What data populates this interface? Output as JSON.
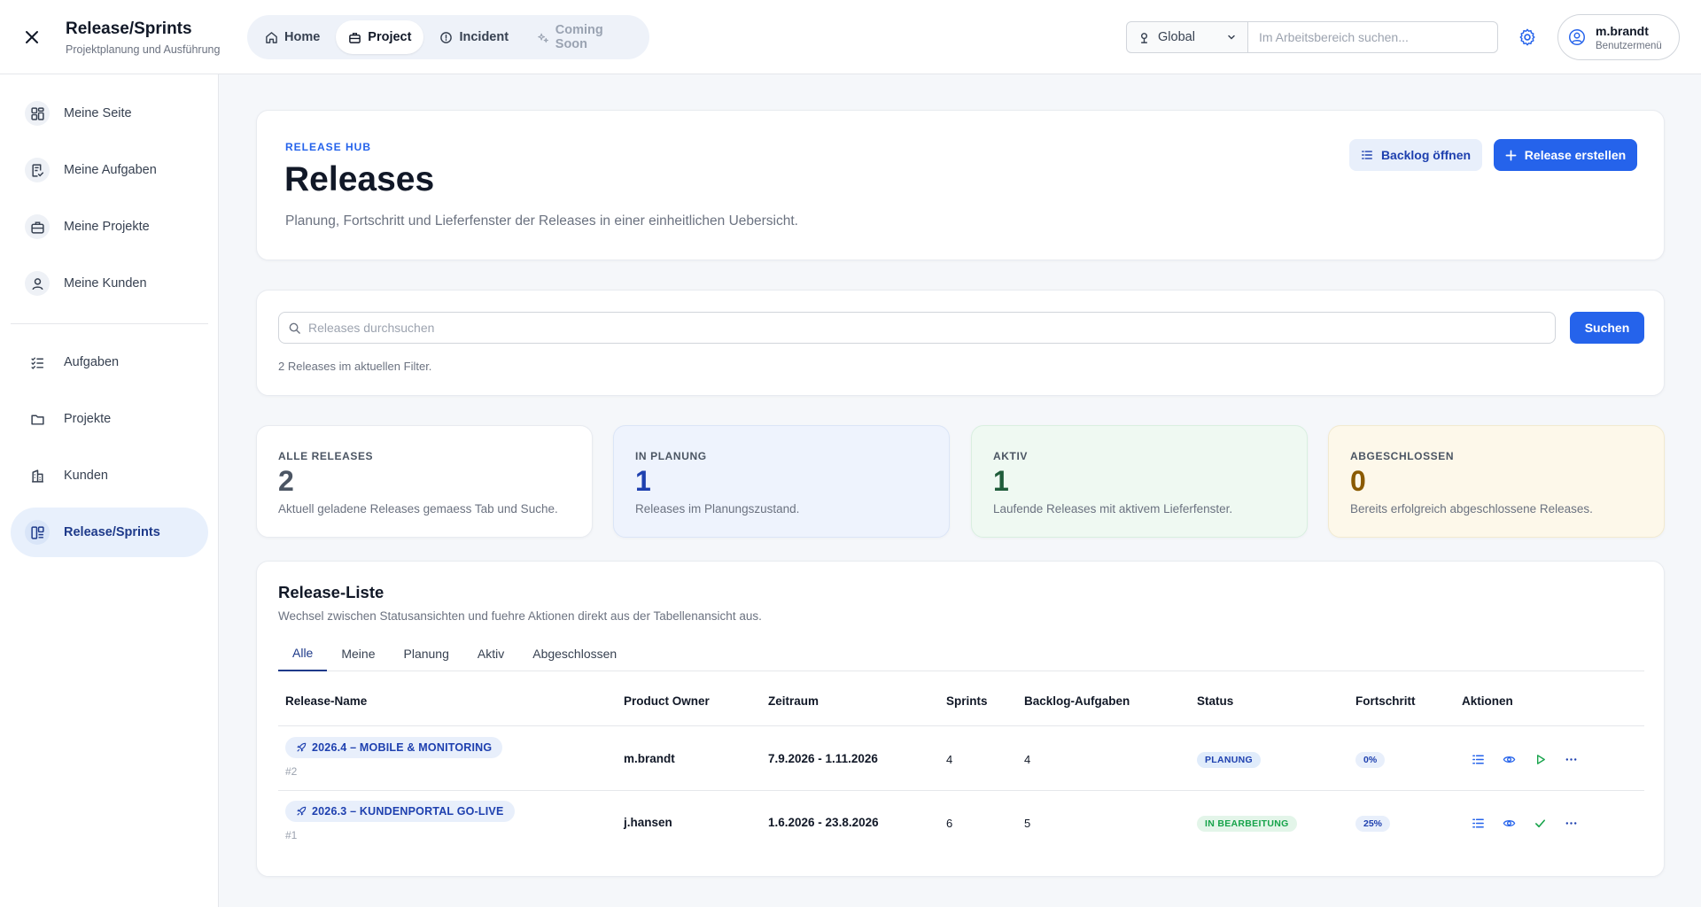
{
  "header": {
    "title": "Release/Sprints",
    "subtitle": "Projektplanung und Ausführung",
    "nav": [
      {
        "label": "Home",
        "icon": "home-icon"
      },
      {
        "label": "Project",
        "icon": "briefcase-icon"
      },
      {
        "label": "Incident",
        "icon": "alert-circle-icon"
      },
      {
        "label": "Coming Soon",
        "icon": "sparkle-icon"
      }
    ],
    "scope": "Global",
    "search_placeholder": "Im Arbeitsbereich suchen...",
    "user": {
      "name": "m.brandt",
      "role": "Benutzermenü"
    }
  },
  "sidebar": {
    "items": [
      {
        "label": "Meine Seite"
      },
      {
        "label": "Meine Aufgaben"
      },
      {
        "label": "Meine Projekte"
      },
      {
        "label": "Meine Kunden"
      },
      {
        "label": "Aufgaben"
      },
      {
        "label": "Projekte"
      },
      {
        "label": "Kunden"
      },
      {
        "label": "Release/Sprints"
      }
    ]
  },
  "hero": {
    "eyebrow": "RELEASE HUB",
    "title": "Releases",
    "description": "Planung, Fortschritt und Lieferfenster der Releases in einer einheitlichen Uebersicht.",
    "secondary_button": "Backlog öffnen",
    "primary_button": "Release erstellen"
  },
  "search": {
    "placeholder": "Releases durchsuchen",
    "button": "Suchen",
    "filter_note": "2 Releases im aktuellen Filter."
  },
  "stats": [
    {
      "label": "ALLE RELEASES",
      "value": "2",
      "desc": "Aktuell geladene Releases gemaess Tab und Suche."
    },
    {
      "label": "IN PLANUNG",
      "value": "1",
      "desc": "Releases im Planungszustand."
    },
    {
      "label": "AKTIV",
      "value": "1",
      "desc": "Laufende Releases mit aktivem Lieferfenster."
    },
    {
      "label": "ABGESCHLOSSEN",
      "value": "0",
      "desc": "Bereits erfolgreich abgeschlossene Releases."
    }
  ],
  "list": {
    "title": "Release-Liste",
    "description": "Wechsel zwischen Statusansichten und fuehre Aktionen direkt aus der Tabellenansicht aus.",
    "tabs": [
      "Alle",
      "Meine",
      "Planung",
      "Aktiv",
      "Abgeschlossen"
    ],
    "columns": [
      "Release-Name",
      "Product Owner",
      "Zeitraum",
      "Sprints",
      "Backlog-Aufgaben",
      "Status",
      "Fortschritt",
      "Aktionen"
    ],
    "rows": [
      {
        "name": "2026.4 – MOBILE & MONITORING",
        "id": "#2",
        "owner": "m.brandt",
        "period": "7.9.2026 - 1.11.2026",
        "sprints": "4",
        "backlog": "4",
        "status": "PLANUNG",
        "progress": "0%",
        "progress_value": 0
      },
      {
        "name": "2026.3 – KUNDENPORTAL GO-LIVE",
        "id": "#1",
        "owner": "j.hansen",
        "period": "1.6.2026 - 23.8.2026",
        "sprints": "6",
        "backlog": "5",
        "status": "IN BEARBEITUNG",
        "progress": "25%",
        "progress_value": 25
      }
    ]
  },
  "colors": {
    "accent": "#2563eb",
    "planning_badge": "#e0ecfb",
    "progress_badge": "#e3f5e9"
  }
}
